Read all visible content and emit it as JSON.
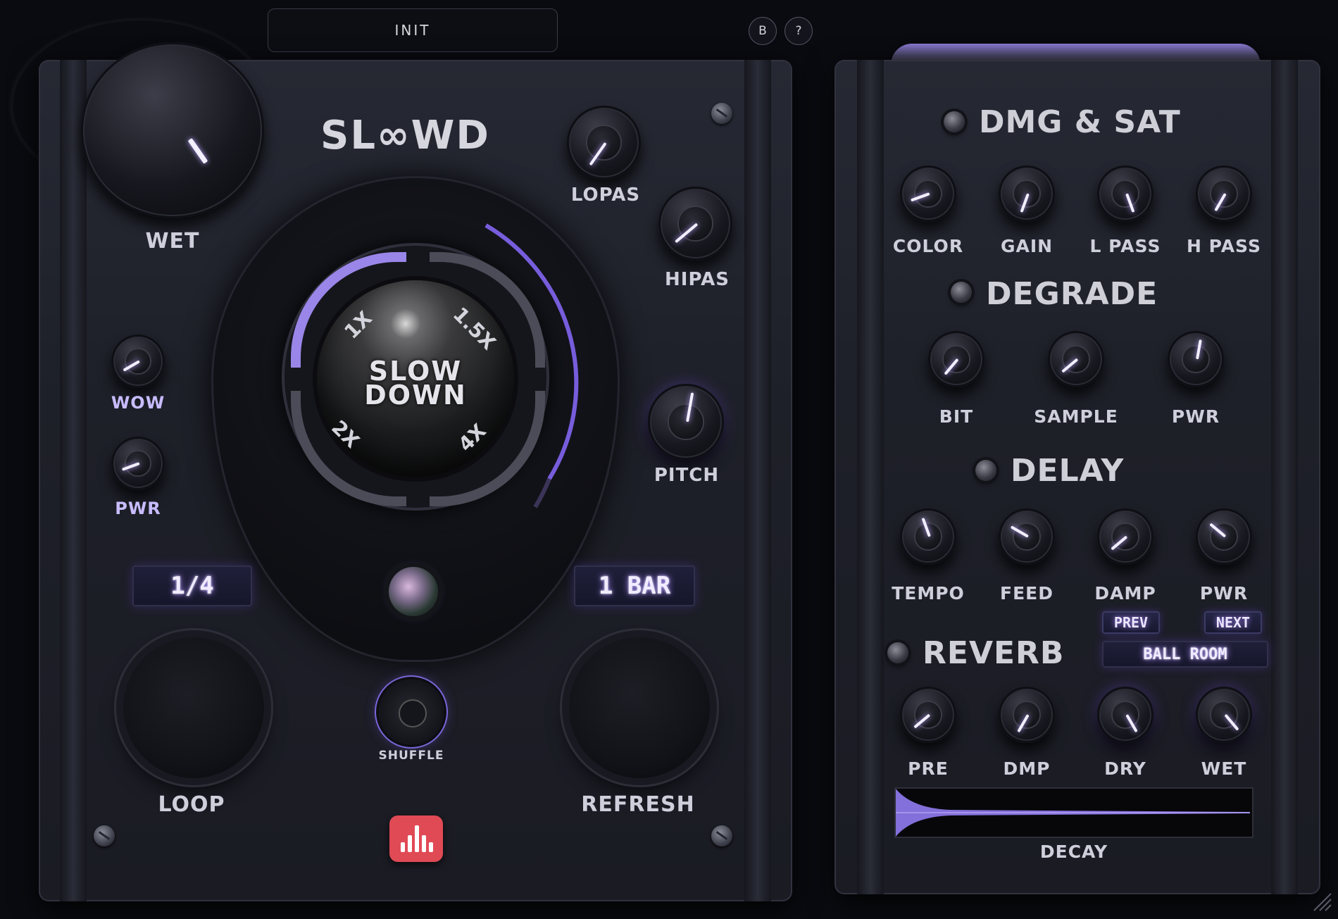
{
  "header": {
    "preset_name": "INIT",
    "b_button": "B",
    "help_button": "?"
  },
  "left_panel": {
    "brand": "SL∞WD",
    "knobs": {
      "wet": "WET",
      "lopas": "LOPAS",
      "hipas": "HIPAS",
      "wow": "WOW",
      "pwr": "PWR",
      "pitch": "PITCH"
    },
    "slowdown": {
      "center_line1": "SLOW",
      "center_line2": "DOWN",
      "speeds": [
        "1X",
        "1.5X",
        "2X",
        "4X"
      ]
    },
    "loop_display": "1/4",
    "refresh_display": "1 BAR",
    "loop_label": "LOOP",
    "refresh_label": "REFRESH",
    "shuffle_label": "SHUFFLE"
  },
  "right_panel": {
    "dmg_sat": {
      "title": "DMG & SAT",
      "knobs": [
        "COLOR",
        "GAIN",
        "L PASS",
        "H PASS"
      ]
    },
    "degrade": {
      "title": "DEGRADE",
      "knobs": [
        "BIT",
        "SAMPLE",
        "PWR"
      ]
    },
    "delay": {
      "title": "DELAY",
      "knobs": [
        "TEMPO",
        "FEED",
        "DAMP",
        "PWR"
      ]
    },
    "reverb": {
      "title": "REVERB",
      "prev": "PREV",
      "next": "NEXT",
      "preset": "BALL ROOM",
      "knobs": [
        "PRE",
        "DMP",
        "DRY",
        "WET"
      ],
      "decay_label": "DECAY"
    }
  },
  "colors": {
    "accent": "#9b7bff",
    "logo": "#e04a55",
    "panel": "#1e2029"
  }
}
